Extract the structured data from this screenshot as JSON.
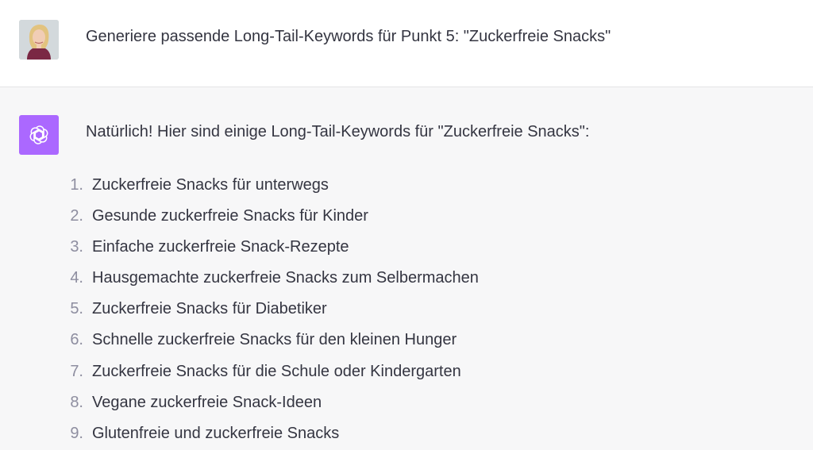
{
  "user_message": {
    "text": "Generiere passende Long-Tail-Keywords für Punkt 5: \"Zuckerfreie Snacks\"",
    "avatar": "user-photo-avatar"
  },
  "assistant_message": {
    "avatar": "openai-logo-icon",
    "avatar_color": "#ab68ff",
    "intro": "Natürlich! Hier sind einige Long-Tail-Keywords für \"Zuckerfreie Snacks\":",
    "items": [
      {
        "num": "1.",
        "text": "Zuckerfreie Snacks für unterwegs"
      },
      {
        "num": "2.",
        "text": "Gesunde zuckerfreie Snacks für Kinder"
      },
      {
        "num": "3.",
        "text": "Einfache zuckerfreie Snack-Rezepte"
      },
      {
        "num": "4.",
        "text": "Hausgemachte zuckerfreie Snacks zum Selbermachen"
      },
      {
        "num": "5.",
        "text": "Zuckerfreie Snacks für Diabetiker"
      },
      {
        "num": "6.",
        "text": "Schnelle zuckerfreie Snacks für den kleinen Hunger"
      },
      {
        "num": "7.",
        "text": "Zuckerfreie Snacks für die Schule oder Kindergarten"
      },
      {
        "num": "8.",
        "text": "Vegane zuckerfreie Snack-Ideen"
      },
      {
        "num": "9.",
        "text": "Glutenfreie und zuckerfreie Snacks"
      }
    ]
  }
}
